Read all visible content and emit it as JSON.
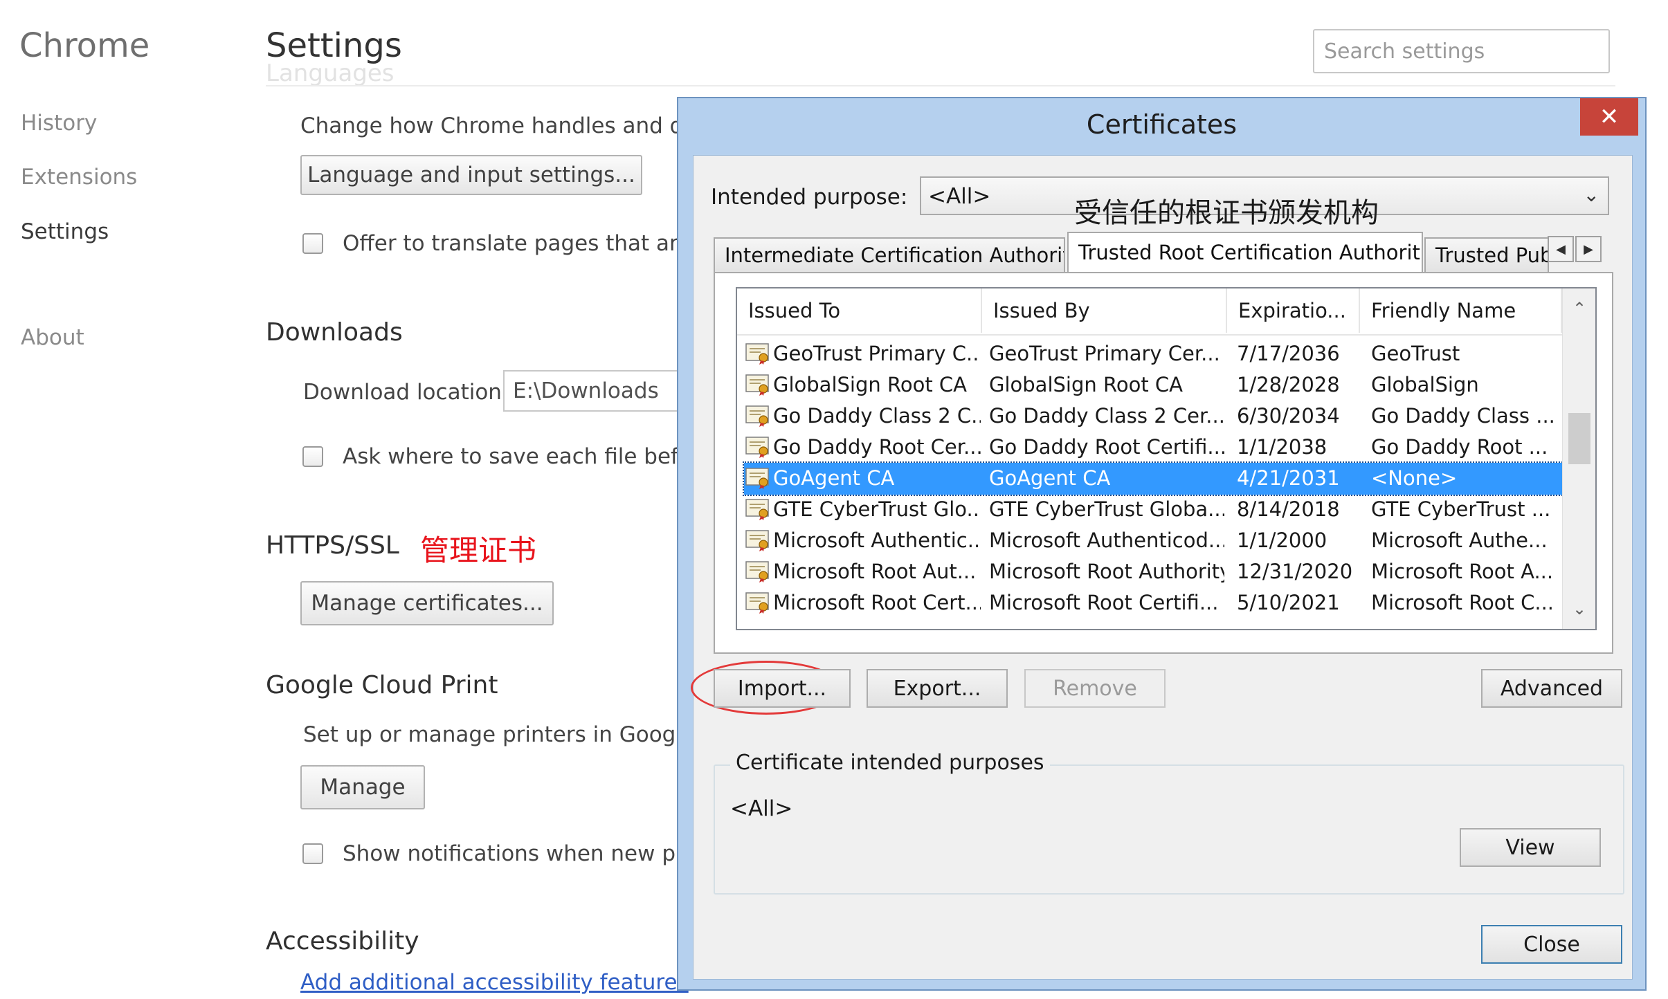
{
  "chrome": {
    "brand": "Chrome",
    "nav": [
      "History",
      "Extensions",
      "Settings",
      "About"
    ],
    "search_placeholder": "Search settings",
    "page_title": "Settings",
    "faded_heading": "Languages",
    "languages": {
      "desc": "Change how Chrome handles and disp",
      "button": "Language and input settings...",
      "translate_checkbox": "Offer to translate pages that aren'"
    },
    "downloads": {
      "heading": "Downloads",
      "location_label": "Download location:",
      "location_value": "E:\\Downloads",
      "ask_checkbox": "Ask where to save each file before"
    },
    "https": {
      "heading": "HTTPS/SSL",
      "annotation": "管理证书",
      "button": "Manage certificates..."
    },
    "cloud_print": {
      "heading": "Google Cloud Print",
      "desc": "Set up or manage printers in Google C",
      "button": "Manage",
      "notify_checkbox": "Show notifications when new print"
    },
    "accessibility": {
      "heading": "Accessibility",
      "link": "Add additional accessibility features"
    }
  },
  "dialog": {
    "title": "Certificates",
    "close_glyph": "✕",
    "purpose_label": "Intended purpose:",
    "purpose_value": "<All>",
    "annotation": "受信任的根证书颁发机构",
    "tabs": [
      "Intermediate Certification Authorities",
      "Trusted Root Certification Authorities",
      "Trusted Publ"
    ],
    "columns": [
      "Issued To",
      "Issued By",
      "Expiratio...",
      "Friendly Name"
    ],
    "rows": [
      {
        "to": "GeoTrust Primary C...",
        "by": "GeoTrust Primary Cer...",
        "exp": "7/17/2036",
        "name": "GeoTrust"
      },
      {
        "to": "GlobalSign Root CA",
        "by": "GlobalSign Root CA",
        "exp": "1/28/2028",
        "name": "GlobalSign"
      },
      {
        "to": "Go Daddy Class 2 C...",
        "by": "Go Daddy Class 2 Cer...",
        "exp": "6/30/2034",
        "name": "Go Daddy Class ..."
      },
      {
        "to": "Go Daddy Root Cer...",
        "by": "Go Daddy Root Certifi...",
        "exp": "1/1/2038",
        "name": "Go Daddy Root ..."
      },
      {
        "to": "GoAgent CA",
        "by": "GoAgent CA",
        "exp": "4/21/2031",
        "name": "<None>"
      },
      {
        "to": "GTE CyberTrust Glo...",
        "by": "GTE CyberTrust Globa...",
        "exp": "8/14/2018",
        "name": "GTE CyberTrust ..."
      },
      {
        "to": "Microsoft Authentic...",
        "by": "Microsoft Authenticod...",
        "exp": "1/1/2000",
        "name": "Microsoft Authe..."
      },
      {
        "to": "Microsoft Root Aut...",
        "by": "Microsoft Root Authority",
        "exp": "12/31/2020",
        "name": "Microsoft Root A..."
      },
      {
        "to": "Microsoft Root Cert...",
        "by": "Microsoft Root Certifi...",
        "exp": "5/10/2021",
        "name": "Microsoft Root C..."
      }
    ],
    "buttons": {
      "import": "Import...",
      "export": "Export...",
      "remove": "Remove",
      "advanced": "Advanced",
      "view": "View",
      "close": "Close"
    },
    "purposes_legend": "Certificate intended purposes",
    "purposes_value": "<All>"
  }
}
